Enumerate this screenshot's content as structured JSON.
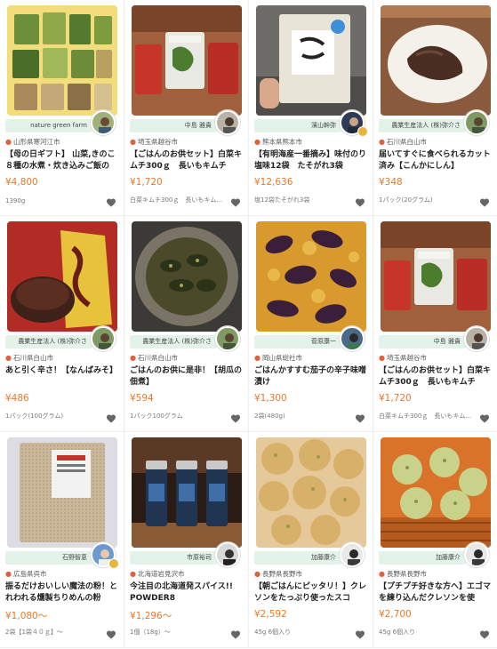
{
  "products": [
    {
      "producer": "nature green farm",
      "location": "山形県寒河江市",
      "title": "【母の日ギフト】 山菜,きのこ８種の水煮・炊き込みご飯の",
      "price": "¥4,800",
      "spec": "1390g",
      "badge": false
    },
    {
      "producer": "中島 雅貴",
      "location": "埼玉県越谷市",
      "title": "【ごはんのお供セット】白菜キムチ300ｇ　長いもキムチ",
      "price": "¥1,720",
      "spec": "白菜キムチ300ｇ　長いもキム…",
      "badge": false
    },
    {
      "producer": "濱山幹弥",
      "location": "熊本県熊本市",
      "title": "【有明海産一番摘み】味付のり 塩味12袋　たそがれ3袋",
      "price": "¥12,636",
      "spec": "塩12袋たそがれ3袋",
      "badge": true
    },
    {
      "producer": "農業生産法人 (株)弥介さ",
      "location": "石川県白山市",
      "title": "届いてすぐに食べられるカット済み【こんかにしん】",
      "price": "¥348",
      "spec": "1パック(20グラム)",
      "badge": false
    },
    {
      "producer": "農業生産法人 (株)弥介さ",
      "location": "石川県白山市",
      "title": "あと引く辛さ！【なんばみそ】",
      "price": "¥486",
      "spec": "1パック(100グラム)",
      "badge": false
    },
    {
      "producer": "農業生産法人 (株)弥介さ",
      "location": "石川県白山市",
      "title": "ごはんのお供に是非！【胡瓜の佃煮】",
      "price": "¥594",
      "spec": "1パック100グラム",
      "badge": false
    },
    {
      "producer": "菅原康一",
      "location": "岡山県総社市",
      "title": "ごはんかすすむ茄子の辛子味噌漬け",
      "price": "¥1,300",
      "spec": "2袋(480g)",
      "badge": false
    },
    {
      "producer": "中島 雅貴",
      "location": "埼玉県越谷市",
      "title": "【ごはんのお供セット】白菜キムチ300ｇ　長いもキムチ",
      "price": "¥1,720",
      "spec": "白菜キムチ300ｇ　長いもキム…",
      "badge": false
    },
    {
      "producer": "石野智恵",
      "location": "広島県呉市",
      "title": "振るだけおいしい魔法の粉！とれわれる燻製ちりめんの粉",
      "price": "¥1,080〜",
      "spec": "2袋【1袋４０ｇ】〜",
      "badge": true
    },
    {
      "producer": "市原裕司",
      "location": "北海道岩見沢市",
      "title": "今注目の北海道発スパイス!! POWDER8",
      "price": "¥1,296〜",
      "spec": "1個（18g）〜",
      "badge": false
    },
    {
      "producer": "加藤康介",
      "location": "長野県長野市",
      "title": "【朝ごはんにピッタリ！】クレソンをたっぷり使ったスコ",
      "price": "¥2,592",
      "spec": "45g 6個入り",
      "badge": false
    },
    {
      "producer": "加藤康介",
      "location": "長野県長野市",
      "title": "【プチプチ好きな方へ】エゴマを練り込んだクレソンを使",
      "price": "¥2,700",
      "spec": "45g 6個入り",
      "badge": false
    }
  ]
}
